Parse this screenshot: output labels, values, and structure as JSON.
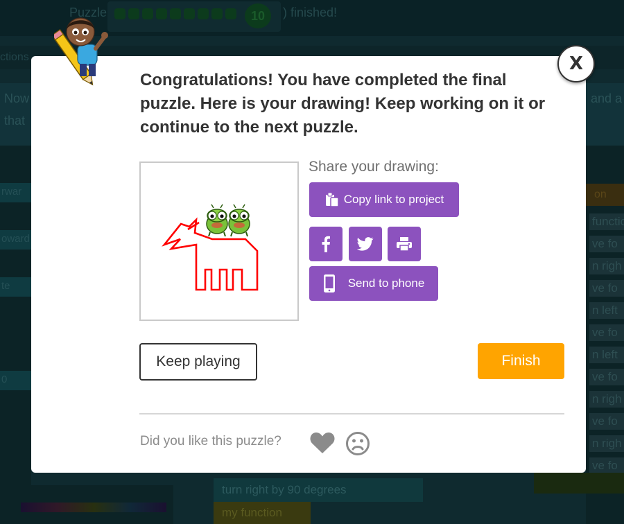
{
  "background": {
    "progress_label": "Puzzle",
    "progress_count": "10",
    "progress_suffix": ") finished!",
    "tabs_text": "ctions",
    "instructions_line1": "Now",
    "instructions_line2": "that",
    "instructions_right": "and a",
    "left_blocks": [
      "rwar",
      "oward",
      "te",
      "0"
    ],
    "right_blocks": [
      "on",
      "function",
      "ve fo",
      "n righ",
      "ve fo",
      "n left",
      "ve fo",
      "n left",
      "ve fo",
      "n righ",
      "ve fo",
      "n righ",
      "ve fo"
    ],
    "code_block": "turn  right  by  90  degrees",
    "code_block_2": "my function"
  },
  "modal": {
    "close_label": "X",
    "title": "Congratulations! You have completed the final puzzle. Here is your drawing! Keep working on it or continue to the next puzzle.",
    "share_label": "Share your drawing:",
    "copy_link_label": "Copy link to project",
    "send_to_phone_label": "Send to phone",
    "keep_playing_label": "Keep playing",
    "finish_label": "Finish",
    "feedback_question": "Did you like this puzzle?"
  },
  "colors": {
    "purple": "#8c52be",
    "orange": "#ffa400",
    "drawing_red": "#ff0000"
  },
  "icons": {
    "copy": "clipboard-icon",
    "facebook": "facebook-icon",
    "twitter": "twitter-icon",
    "print": "print-icon",
    "phone": "phone-icon",
    "like": "heart-icon",
    "dislike": "frown-icon",
    "close": "close-icon"
  }
}
